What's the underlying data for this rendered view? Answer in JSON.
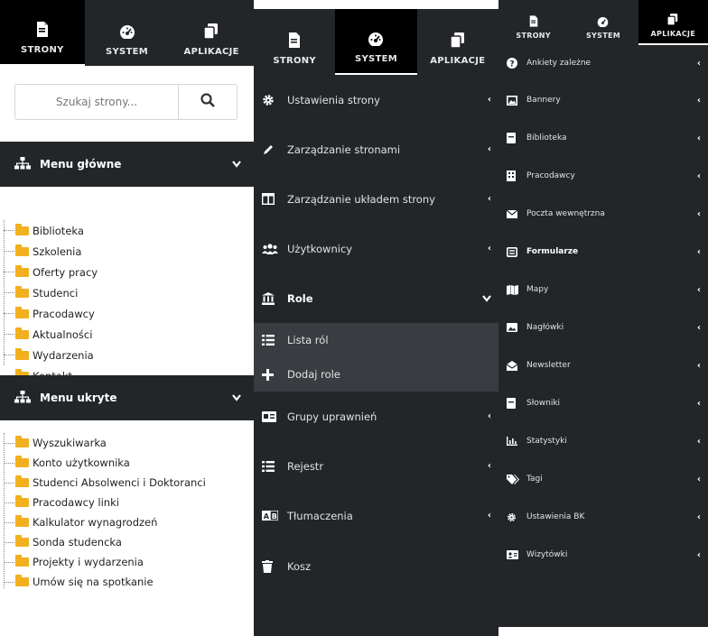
{
  "panel1": {
    "tabs": [
      {
        "label": "STRONY",
        "icon": "file-icon",
        "active": true
      },
      {
        "label": "SYSTEM",
        "icon": "dashboard-icon",
        "active": false
      },
      {
        "label": "APLIKACJE",
        "icon": "copy-icon",
        "active": false
      }
    ],
    "search": {
      "placeholder": "Szukaj strony..."
    },
    "main_menu": {
      "title": "Menu główne",
      "items": [
        "Biblioteka",
        "Szkolenia",
        "Oferty pracy",
        "Studenci",
        "Pracodawcy",
        "Aktualności",
        "Wydarzenia",
        "Kontakt"
      ]
    },
    "hidden_menu": {
      "title": "Menu ukryte",
      "items": [
        "Wyszukiwarka",
        "Konto użytkownika",
        "Studenci Absolwenci i Doktoranci",
        "Pracodawcy linki",
        "Kalkulator wynagrodzeń",
        "Sonda studencka",
        "Projekty i wydarzenia",
        "Umów się na spotkanie"
      ]
    }
  },
  "panel2": {
    "tabs": [
      {
        "label": "STRONY",
        "icon": "file-icon",
        "active": false
      },
      {
        "label": "SYSTEM",
        "icon": "dashboard-icon",
        "active": true
      },
      {
        "label": "APLIKACJE",
        "icon": "copy-icon",
        "active": false
      }
    ],
    "items": [
      {
        "label": "Ustawienia strony",
        "icon": "gear-icon"
      },
      {
        "label": "Zarządzanie stronami",
        "icon": "pencil-icon"
      },
      {
        "label": "Zarządzanie układem strony",
        "icon": "columns-icon"
      },
      {
        "label": "Użytkownicy",
        "icon": "users-icon"
      },
      {
        "label": "Role",
        "icon": "bank-icon",
        "expanded": true
      },
      {
        "label": "Grupy uprawnień",
        "icon": "id-card-icon"
      },
      {
        "label": "Rejestr",
        "icon": "list-icon"
      },
      {
        "label": "Tłumaczenia",
        "icon": "language-icon"
      },
      {
        "label": "Kosz",
        "icon": "trash-icon"
      }
    ],
    "subitems": [
      {
        "label": "Lista ról",
        "icon": "list-icon"
      },
      {
        "label": "Dodaj role",
        "icon": "plus-icon"
      }
    ]
  },
  "panel3": {
    "tabs": [
      {
        "label": "STRONY",
        "icon": "file-icon",
        "active": false
      },
      {
        "label": "SYSTEM",
        "icon": "dashboard-icon",
        "active": false
      },
      {
        "label": "APLIKACJE",
        "icon": "copy-icon",
        "active": true
      }
    ],
    "items": [
      {
        "label": "Ankiety zależne",
        "icon": "question-icon"
      },
      {
        "label": "Bannery",
        "icon": "image-frame-icon"
      },
      {
        "label": "Biblioteka",
        "icon": "book-icon"
      },
      {
        "label": "Pracodawcy",
        "icon": "building-icon"
      },
      {
        "label": "Poczta wewnętrzna",
        "icon": "envelope-icon"
      },
      {
        "label": "Formularze",
        "icon": "form-icon",
        "active": true
      },
      {
        "label": "Mapy",
        "icon": "map-icon"
      },
      {
        "label": "Nagłówki",
        "icon": "picture-icon"
      },
      {
        "label": "Newsletter",
        "icon": "envelope-open-icon"
      },
      {
        "label": "Słowniki",
        "icon": "book-icon"
      },
      {
        "label": "Statystyki",
        "icon": "chart-icon"
      },
      {
        "label": "Tagi",
        "icon": "tags-icon"
      },
      {
        "label": "Ustawienia BK",
        "icon": "gear-icon"
      },
      {
        "label": "Wizytówki",
        "icon": "address-card-icon"
      }
    ]
  },
  "colors": {
    "dark": "#232629",
    "active_tab": "#000000",
    "submenu_bg": "#393d42",
    "folder": "#f2b01e",
    "text_light": "#e2e2e2"
  }
}
